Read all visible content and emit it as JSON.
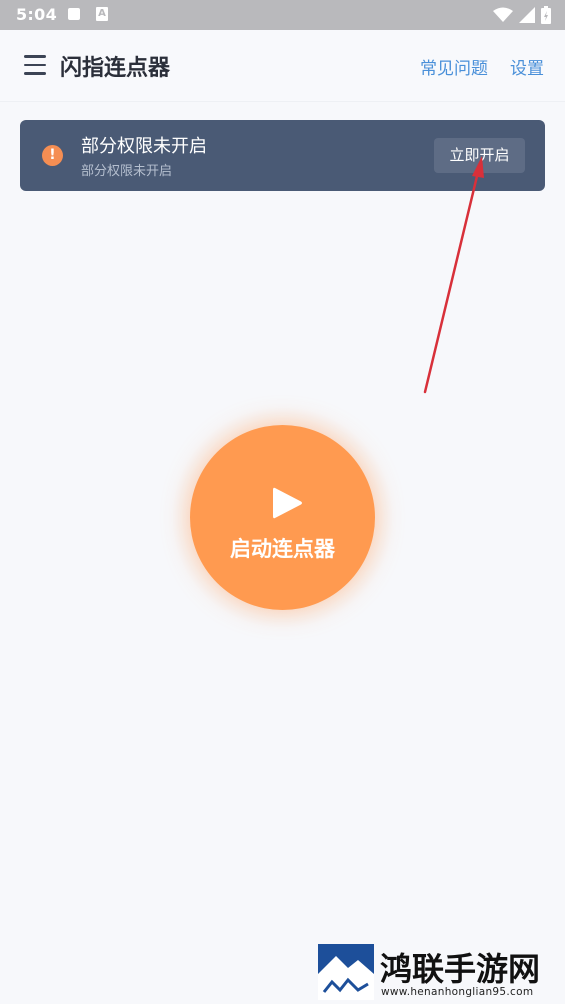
{
  "status_bar": {
    "time": "5:04",
    "notification_icon": "square-notification-icon",
    "app_icon_letter": "A",
    "right_icons": [
      "wifi-icon",
      "signal-icon",
      "battery-icon"
    ]
  },
  "header": {
    "title": "闪指连点器",
    "faq_label": "常见问题",
    "settings_label": "设置",
    "menu_icon": "hamburger-menu-icon"
  },
  "permission_banner": {
    "title": "部分权限未开启",
    "subtitle": "部分权限未开启",
    "button_label": "立即开启",
    "icon": "warning-icon",
    "icon_glyph": "!",
    "accent_color": "#f58e53",
    "background_color": "#4a5a75"
  },
  "start": {
    "label": "启动连点器",
    "icon": "play-icon",
    "color": "#ff9a50"
  },
  "annotation": {
    "color": "#d8303a",
    "icon": "red-arrow-annotation"
  },
  "watermark": {
    "title": "鸿联手游网",
    "url": "www.henanhonglian95.com"
  }
}
